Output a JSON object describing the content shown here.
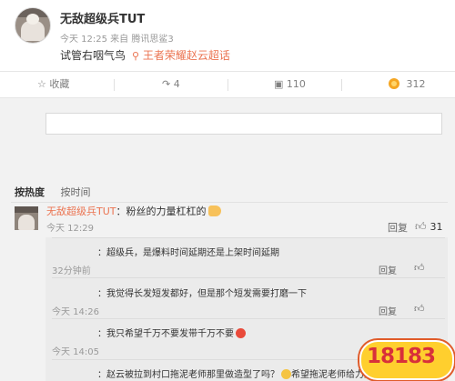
{
  "post": {
    "author": "无敌超级兵TUT",
    "meta": "今天 12:25 来自 腾讯思鲨3",
    "content": "试管右咽气鸟",
    "topic": "王者荣耀赵云超话",
    "topic_icon": "location-pin-icon"
  },
  "actions": {
    "favorite": "收藏",
    "share_count": "4",
    "comment_count": "110",
    "like_count": "312"
  },
  "sort": {
    "hot": "按热度",
    "time": "按时间"
  },
  "comment": {
    "name": "无敌超级兵TUT",
    "text": "：粉丝的力量杠杠的",
    "time": "今天 12:29",
    "reply": "回复",
    "likes": "31"
  },
  "sub_comments": [
    {
      "text": "：超级兵，是爆料时间延期还是上架时间延期",
      "time": "32分钟前",
      "reply": "回复"
    },
    {
      "text": "：我觉得长发短发都好，但是那个短发需要打磨一下",
      "time": "今天 14:26",
      "reply": "回复"
    },
    {
      "text": "：我只希望千万不要发带千万不要",
      "time": "今天 14:05",
      "reply": "回复"
    },
    {
      "text": "：赵云被拉到村口拖泥老师那里做造型了吗？",
      "tail": "希望拖泥老师给力点",
      "time": "",
      "reply": ""
    }
  ],
  "watermark": "18183",
  "colors": {
    "accent": "#eb7350",
    "muted": "#999999",
    "coin": "#f5a623"
  }
}
